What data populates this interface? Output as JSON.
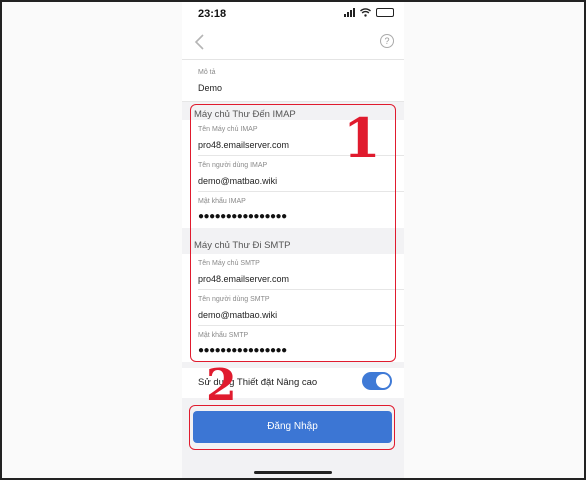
{
  "status_bar": {
    "time": "23:18"
  },
  "description": {
    "label": "Mô tả",
    "value": "Demo"
  },
  "imap": {
    "title": "Máy chủ Thư Đến IMAP",
    "host_label": "Tên Máy chủ IMAP",
    "host_value": "pro48.emailserver.com",
    "user_label": "Tên người dùng IMAP",
    "user_value": "demo@matbao.wiki",
    "pass_label": "Mật khẩu IMAP",
    "pass_value": "●●●●●●●●●●●●●●●●"
  },
  "smtp": {
    "title": "Máy chủ Thư Đi SMTP",
    "host_label": "Tên Máy chủ SMTP",
    "host_value": "pro48.emailserver.com",
    "user_label": "Tên người dùng SMTP",
    "user_value": "demo@matbao.wiki",
    "pass_label": "Mật khẩu SMTP",
    "pass_value": "●●●●●●●●●●●●●●●●"
  },
  "advanced": {
    "label": "Sử dụng Thiết đặt Nâng cao",
    "enabled": true
  },
  "login_button": "Đăng Nhập",
  "annotations": {
    "step1": "1",
    "step2": "2"
  },
  "colors": {
    "accent": "#3c76d4",
    "highlight": "#e01b2e"
  }
}
